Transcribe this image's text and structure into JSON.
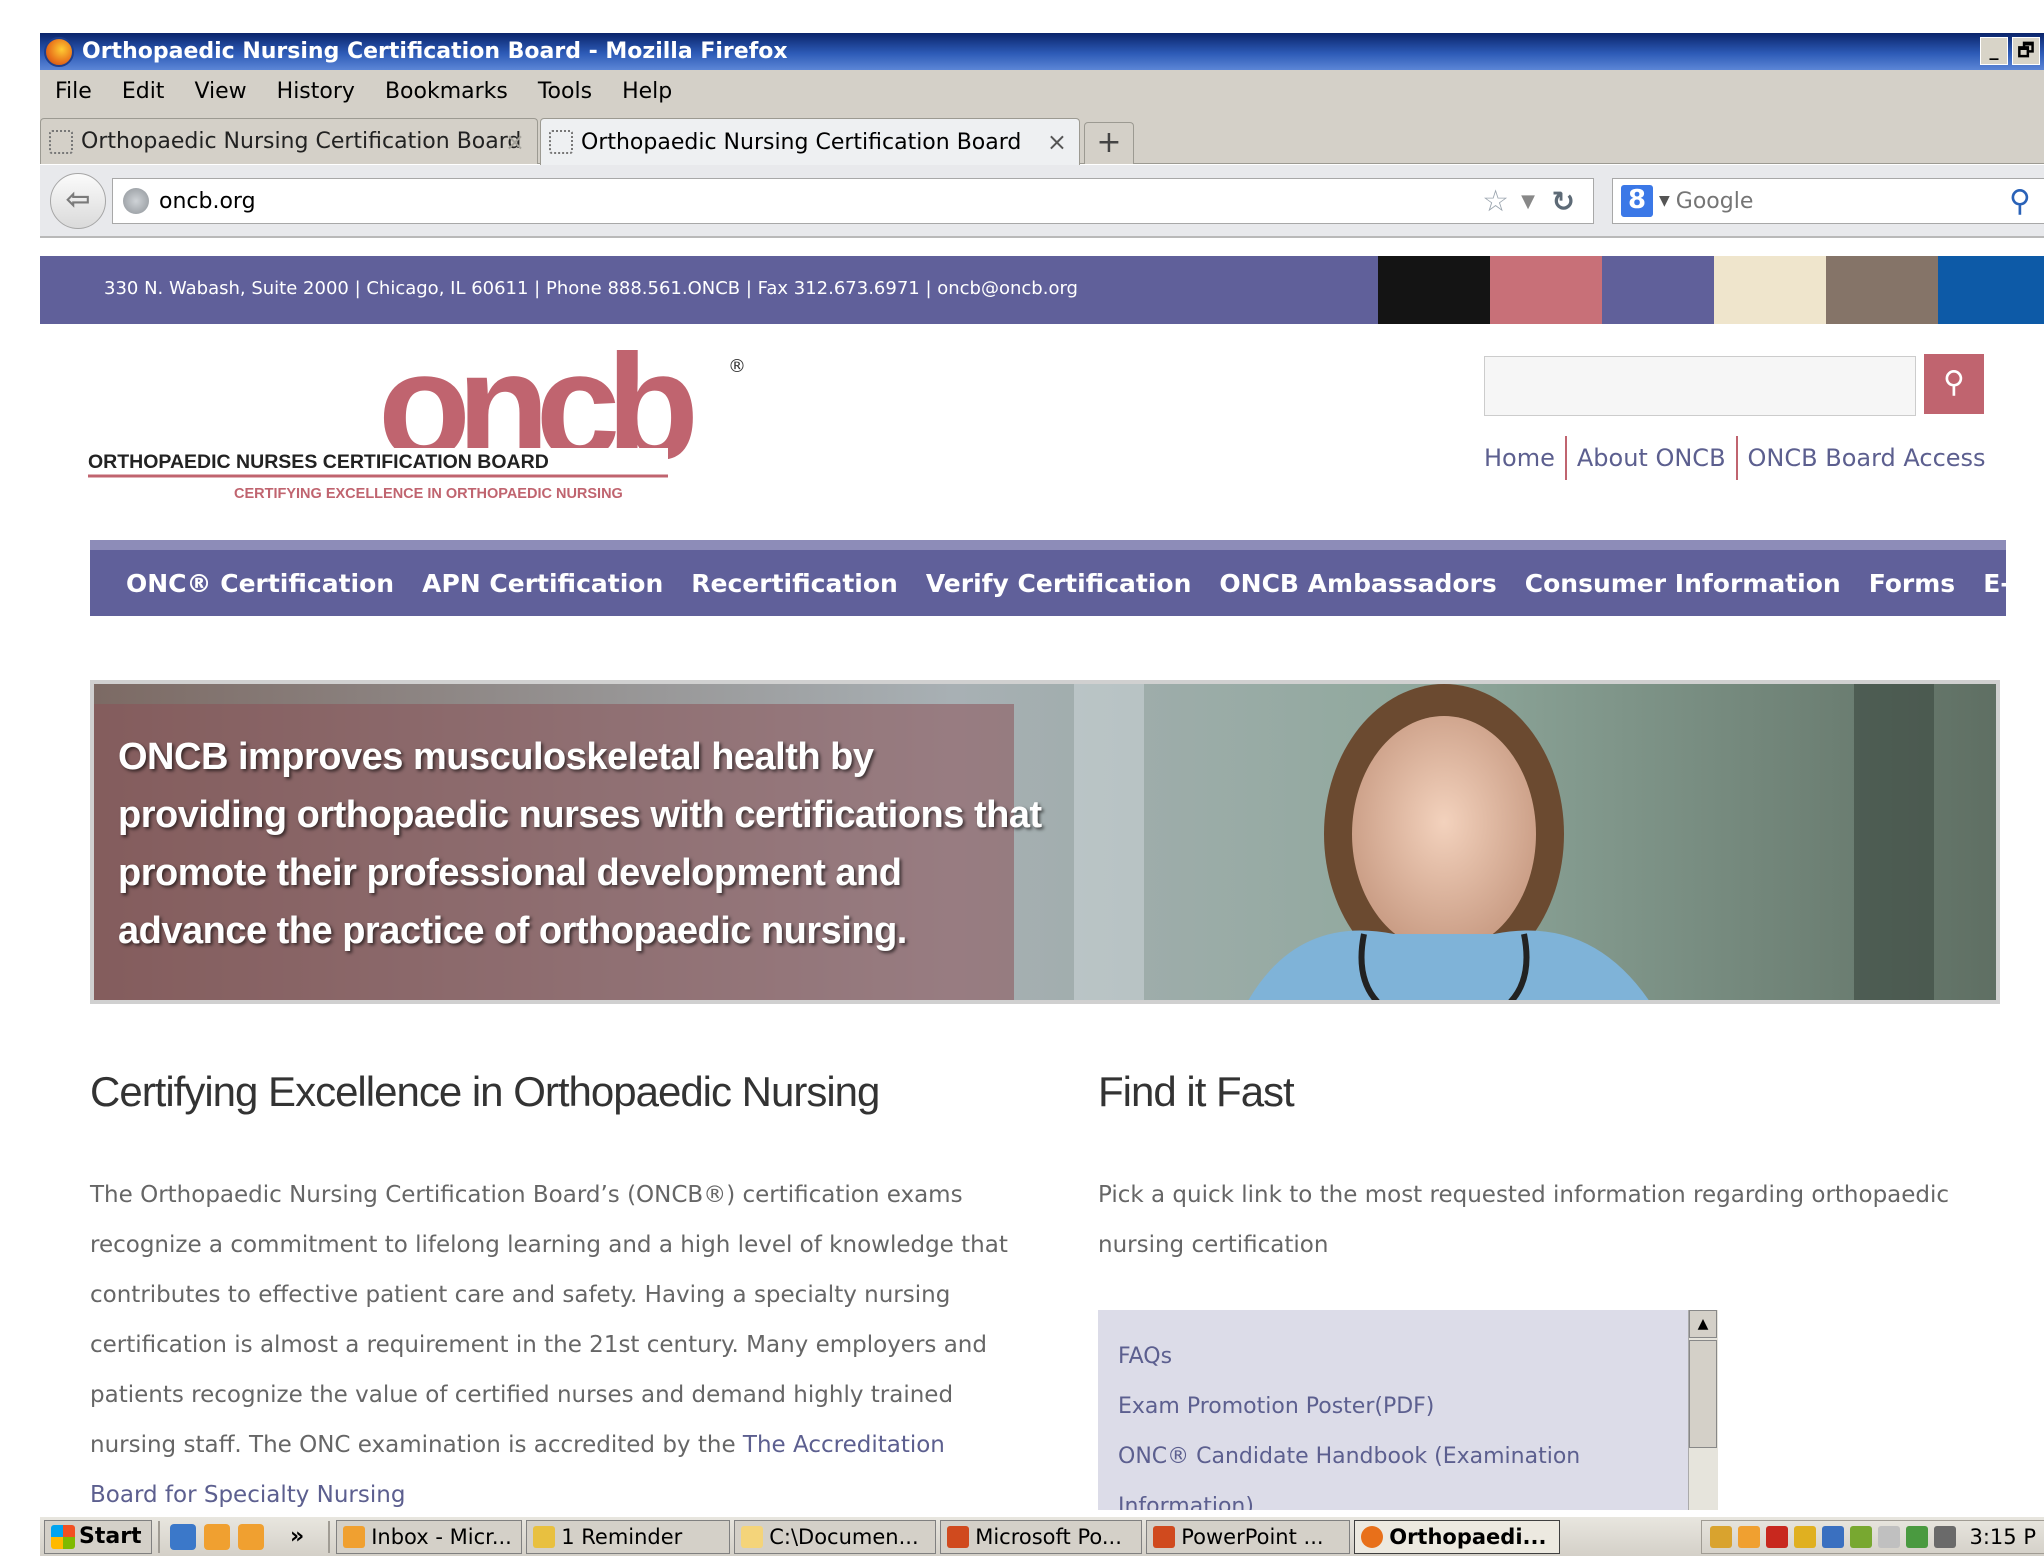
{
  "window": {
    "title": "Orthopaedic Nursing Certification Board - Mozilla Firefox",
    "minimize": "_",
    "restore": "🗗"
  },
  "menu": [
    "File",
    "Edit",
    "View",
    "History",
    "Bookmarks",
    "Tools",
    "Help"
  ],
  "tabs": [
    {
      "label": "Orthopaedic Nursing Certification Board",
      "close": "×"
    },
    {
      "label": "Orthopaedic Nursing Certification Board",
      "close": "×"
    }
  ],
  "new_tab": "+",
  "url": "oncb.org",
  "search_engine_placeholder": "Google",
  "site": {
    "contact": "330 N. Wabash, Suite 2000 | Chicago, IL 60611 | Phone 888.561.ONCB | Fax 312.673.6971 |   oncb@oncb.org",
    "swatch_colors": [
      "#141414",
      "#c87078",
      "#60609a",
      "#efe5cc",
      "#857468",
      "#0d5aa7"
    ],
    "logo": {
      "wordmark": "oncb",
      "registered": "®",
      "name": "ORTHOPAEDIC NURSES CERTIFICATION BOARD",
      "tagline": "CERTIFYING EXCELLENCE IN ORTHOPAEDIC NURSING"
    },
    "search_button": "⚲",
    "utility_links": [
      "Home",
      "About ONCB",
      "ONCB Board Access"
    ],
    "main_nav": [
      "ONC® Certification",
      "APN Certification",
      "Recertification",
      "Verify Certification",
      "ONCB Ambassadors",
      "Consumer Information",
      "Forms",
      "E-Store"
    ],
    "hero_text": "ONCB improves musculoskeletal health by providing orthopaedic nurses with certifications that promote their professional development and advance the practice of orthopaedic nursing.",
    "left": {
      "heading": "Certifying Excellence in Orthopaedic Nursing",
      "body": "The Orthopaedic Nursing Certification Board’s (ONCB®) certification exams recognize a commitment to lifelong learning and a high level of knowledge that contributes to effective patient care and safety. Having a specialty nursing certification is almost a requirement in the 21st century.  Many employers and patients recognize the value of certified nurses and demand highly trained nursing staff. The ONC examination is accredited by the ",
      "link": "The Accreditation Board for Specialty Nursing"
    },
    "right": {
      "heading": "Find it Fast",
      "intro": "Pick a quick link to the most requested information regarding orthopaedic nursing certification",
      "quick_links": [
        "FAQs",
        "Exam Promotion Poster(PDF)",
        "ONC® Candidate Handbook (Examination",
        "Information)"
      ],
      "scroll_up": "▲"
    },
    "colors": {
      "purple": "#60609a",
      "rose": "#c0646f",
      "link": "#5c5f8f"
    }
  },
  "taskbar": {
    "start": "Start",
    "more": "»",
    "buttons": [
      "Inbox - Micr...",
      "1 Reminder",
      "C:\\Documen...",
      "Microsoft Po...",
      "PowerPoint ...",
      "Orthopaedi..."
    ],
    "clock": "3:15 P"
  }
}
